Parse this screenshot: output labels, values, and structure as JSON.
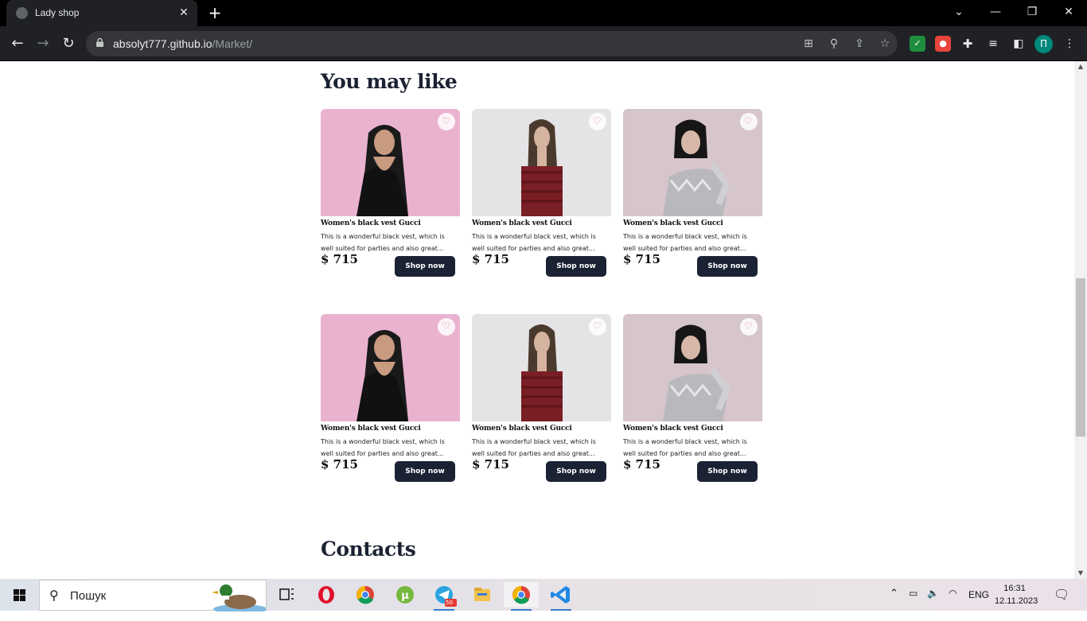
{
  "browser": {
    "tab_title": "Lady shop",
    "url_host": "absolyt777.github.io",
    "url_path": "/Market/",
    "profile_initial": "П"
  },
  "page": {
    "section_title": "You may like",
    "contacts_title": "Contacts",
    "products": [
      {
        "name": "Women's black vest Gucci",
        "description": "This is a wonderful black vest, which is well suited for parties and also great...",
        "price": "$ 715",
        "button": "Shop now",
        "image": "woman-pink-background"
      },
      {
        "name": "Women's black vest Gucci",
        "description": "This is a wonderful black vest, which is well suited for parties and also great...",
        "price": "$ 715",
        "button": "Shop now",
        "image": "woman-red-dress"
      },
      {
        "name": "Women's black vest Gucci",
        "description": "This is a wonderful black vest, which is well suited for parties and also great...",
        "price": "$ 715",
        "button": "Shop now",
        "image": "woman-silver-dress"
      },
      {
        "name": "Women's black vest Gucci",
        "description": "This is a wonderful black vest, which is well suited for parties and also great...",
        "price": "$ 715",
        "button": "Shop now",
        "image": "woman-pink-background"
      },
      {
        "name": "Women's black vest Gucci",
        "description": "This is a wonderful black vest, which is well suited for parties and also great...",
        "price": "$ 715",
        "button": "Shop now",
        "image": "woman-red-dress"
      },
      {
        "name": "Women's black vest Gucci",
        "description": "This is a wonderful black vest, which is well suited for parties and also great...",
        "price": "$ 715",
        "button": "Shop now",
        "image": "woman-silver-dress"
      }
    ]
  },
  "taskbar": {
    "search_placeholder": "Пошук",
    "lang": "ENG",
    "time": "16:31",
    "date": "12.11.2023",
    "telegram_badge": "50"
  },
  "colors": {
    "accent": "#1b2233",
    "heart": "#e57b91"
  }
}
